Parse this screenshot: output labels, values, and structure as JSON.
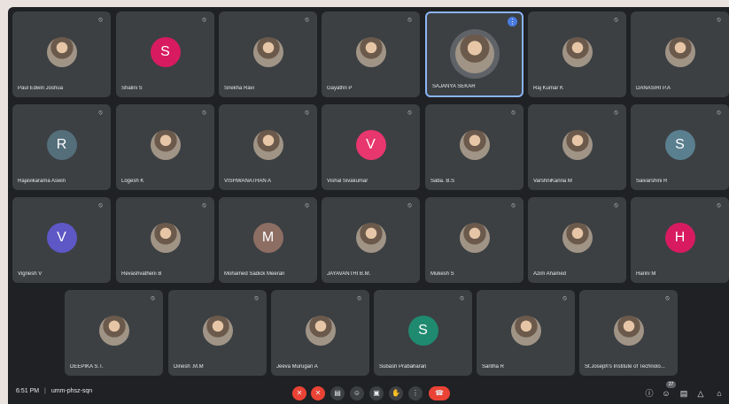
{
  "participants": [
    {
      "name": "Paul Edwin Joshua",
      "avatar": "photo"
    },
    {
      "name": "Shalini S",
      "initial": "S",
      "color": "#d81b60"
    },
    {
      "name": "Snekha Ravi",
      "avatar": "photo"
    },
    {
      "name": "Gayathri P",
      "avatar": "photo"
    },
    {
      "name": "SAJANYA SEKAR",
      "avatar": "photo",
      "active": true
    },
    {
      "name": "Raj Kumar K",
      "avatar": "photo"
    },
    {
      "name": "DANASIRI P.A",
      "avatar": "photo"
    },
    {
      "name": "Rajavikarama Aswin",
      "initial": "R",
      "color": "#546e7a"
    },
    {
      "name": "Logesh K",
      "avatar": "photo"
    },
    {
      "name": "VISHWANATHAN A",
      "avatar": "photo"
    },
    {
      "name": "Vishal Sivakumar",
      "initial": "V",
      "color": "#e8366f"
    },
    {
      "name": "Saba. B.S",
      "avatar": "photo"
    },
    {
      "name": "VarshniKanna M",
      "avatar": "photo"
    },
    {
      "name": "Saivarshini R",
      "initial": "S",
      "color": "#5a7f8f"
    },
    {
      "name": "Vignesh V",
      "initial": "V",
      "color": "#5e57c6"
    },
    {
      "name": "Revashvatheni B",
      "avatar": "photo"
    },
    {
      "name": "Mohamed Sadick Meeran",
      "initial": "M",
      "color": "#8d6e63"
    },
    {
      "name": "JAYAVANTHI B.M.",
      "avatar": "photo"
    },
    {
      "name": "Mukesh S",
      "avatar": "photo"
    },
    {
      "name": "Azim Ahamed",
      "avatar": "photo"
    },
    {
      "name": "Harini M",
      "initial": "H",
      "color": "#d81b60"
    },
    {
      "name": "DEEPIKA S.T.",
      "avatar": "photo"
    },
    {
      "name": "Dinesh .M.M",
      "avatar": "photo"
    },
    {
      "name": "Jeeva Murugan A",
      "avatar": "photo"
    },
    {
      "name": "Subash Prabaharan",
      "initial": "S",
      "color": "#1f8a70"
    },
    {
      "name": "Saritha R",
      "avatar": "photo"
    },
    {
      "name": "St.Joseph's Institute of Technolo...",
      "avatar": "photo"
    }
  ],
  "bottom_bar": {
    "time": "6:51 PM",
    "separator": "|",
    "meeting_code": "umm-phsz-sqn",
    "participant_count": "27",
    "controls": [
      {
        "name": "mic-off",
        "icon": "mic-off-icon",
        "symbol": "✕",
        "style": "red"
      },
      {
        "name": "camera-off",
        "icon": "camera-off-icon",
        "symbol": "✕",
        "style": "red"
      },
      {
        "name": "captions",
        "icon": "captions-icon",
        "symbol": "▤",
        "style": "dark"
      },
      {
        "name": "emoji",
        "icon": "emoji-icon",
        "symbol": "☺",
        "style": "dark"
      },
      {
        "name": "present",
        "icon": "present-icon",
        "symbol": "▣",
        "style": "dark"
      },
      {
        "name": "raise-hand",
        "icon": "hand-icon",
        "symbol": "✋",
        "style": "dark"
      },
      {
        "name": "more-options",
        "icon": "more-icon",
        "symbol": "⋮",
        "style": "dark"
      },
      {
        "name": "leave-call",
        "icon": "end-call-icon",
        "symbol": "☎",
        "style": "end"
      }
    ],
    "right_controls": [
      {
        "name": "info",
        "icon": "info-icon",
        "symbol": "ⓘ"
      },
      {
        "name": "people",
        "icon": "people-icon",
        "symbol": "☺"
      },
      {
        "name": "chat",
        "icon": "chat-icon",
        "symbol": "▤"
      },
      {
        "name": "activities",
        "icon": "activities-icon",
        "symbol": "△"
      },
      {
        "name": "host-controls",
        "icon": "lock-icon",
        "symbol": "⌂"
      }
    ]
  }
}
